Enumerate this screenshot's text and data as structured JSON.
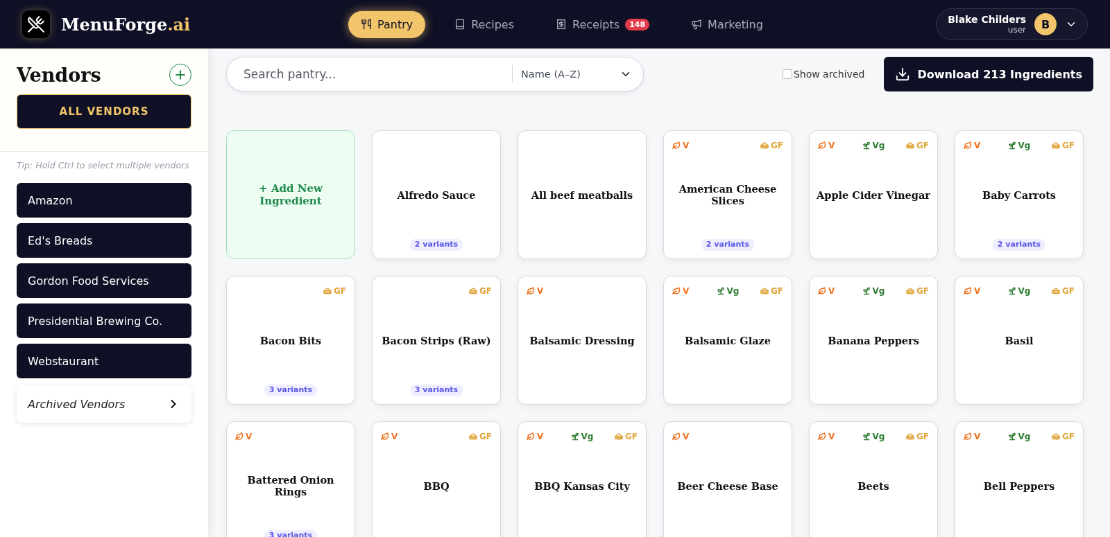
{
  "brand": {
    "name": "MenuForge",
    "suffix": ".ai"
  },
  "nav": [
    {
      "label": "Pantry",
      "selected": true
    },
    {
      "label": "Recipes",
      "selected": false
    },
    {
      "label": "Receipts",
      "selected": false,
      "badge": "148"
    },
    {
      "label": "Marketing",
      "selected": false
    }
  ],
  "user": {
    "name": "Blake Childers",
    "role": "user",
    "initial": "B"
  },
  "sidebar": {
    "title": "Vendors",
    "all_button": "ALL VENDORS",
    "tip": "Tip: Hold Ctrl to select multiple vendors",
    "vendors": [
      "Amazon",
      "Ed's Breads",
      "Gordon Food Services",
      "Presidential Brewing Co.",
      "Webstaurant"
    ],
    "archived": "Archived Vendors"
  },
  "toolbar": {
    "search_placeholder": "Search pantry...",
    "sort": "Name (A–Z)",
    "show_archived": {
      "label": "Show archived",
      "checked": false
    },
    "download": "Download 213 Ingredients"
  },
  "add_card": "+ Add New Ingredient",
  "ingredients": [
    {
      "name": "Alfredo Sauce",
      "variants": "2 variants"
    },
    {
      "name": "All beef meatballs"
    },
    {
      "name": "American Cheese Slices",
      "tags": [
        {
          "kind": "v",
          "label": "V"
        },
        {
          "kind": "gf",
          "label": "GF"
        }
      ],
      "variants": "2 variants"
    },
    {
      "name": "Apple Cider Vinegar",
      "tags": [
        {
          "kind": "v",
          "label": "V"
        },
        {
          "kind": "vg",
          "label": "Vg"
        },
        {
          "kind": "gf",
          "label": "GF"
        }
      ]
    },
    {
      "name": "Baby Carrots",
      "tags": [
        {
          "kind": "v",
          "label": "V"
        },
        {
          "kind": "vg",
          "label": "Vg"
        },
        {
          "kind": "gf",
          "label": "GF"
        }
      ],
      "variants": "2 variants"
    },
    {
      "name": "Bacon Bits",
      "tags": [
        {
          "kind": "gf",
          "label": "GF"
        }
      ],
      "variants": "3 variants"
    },
    {
      "name": "Bacon Strips (Raw)",
      "tags": [
        {
          "kind": "gf",
          "label": "GF"
        }
      ],
      "variants": "3 variants"
    },
    {
      "name": "Balsamic Dressing",
      "tags": [
        {
          "kind": "v",
          "label": "V"
        }
      ]
    },
    {
      "name": "Balsamic Glaze",
      "tags": [
        {
          "kind": "v",
          "label": "V"
        },
        {
          "kind": "vg",
          "label": "Vg"
        },
        {
          "kind": "gf",
          "label": "GF"
        }
      ]
    },
    {
      "name": "Banana Peppers",
      "tags": [
        {
          "kind": "v",
          "label": "V"
        },
        {
          "kind": "vg",
          "label": "Vg"
        },
        {
          "kind": "gf",
          "label": "GF"
        }
      ]
    },
    {
      "name": "Basil",
      "tags": [
        {
          "kind": "v",
          "label": "V"
        },
        {
          "kind": "vg",
          "label": "Vg"
        },
        {
          "kind": "gf",
          "label": "GF"
        }
      ]
    },
    {
      "name": "Battered Onion Rings",
      "tags": [
        {
          "kind": "v",
          "label": "V"
        }
      ],
      "variants": "3 variants"
    },
    {
      "name": "BBQ",
      "tags": [
        {
          "kind": "v",
          "label": "V"
        },
        {
          "kind": "gf",
          "label": "GF"
        }
      ]
    },
    {
      "name": "BBQ Kansas City",
      "tags": [
        {
          "kind": "v",
          "label": "V"
        },
        {
          "kind": "vg",
          "label": "Vg"
        },
        {
          "kind": "gf",
          "label": "GF"
        }
      ]
    },
    {
      "name": "Beer Cheese Base",
      "tags": [
        {
          "kind": "v",
          "label": "V"
        }
      ]
    },
    {
      "name": "Beets",
      "tags": [
        {
          "kind": "v",
          "label": "V"
        },
        {
          "kind": "vg",
          "label": "Vg"
        },
        {
          "kind": "gf",
          "label": "GF"
        }
      ]
    },
    {
      "name": "Bell Peppers",
      "tags": [
        {
          "kind": "v",
          "label": "V"
        },
        {
          "kind": "vg",
          "label": "Vg"
        },
        {
          "kind": "gf",
          "label": "GF"
        }
      ]
    }
  ]
}
